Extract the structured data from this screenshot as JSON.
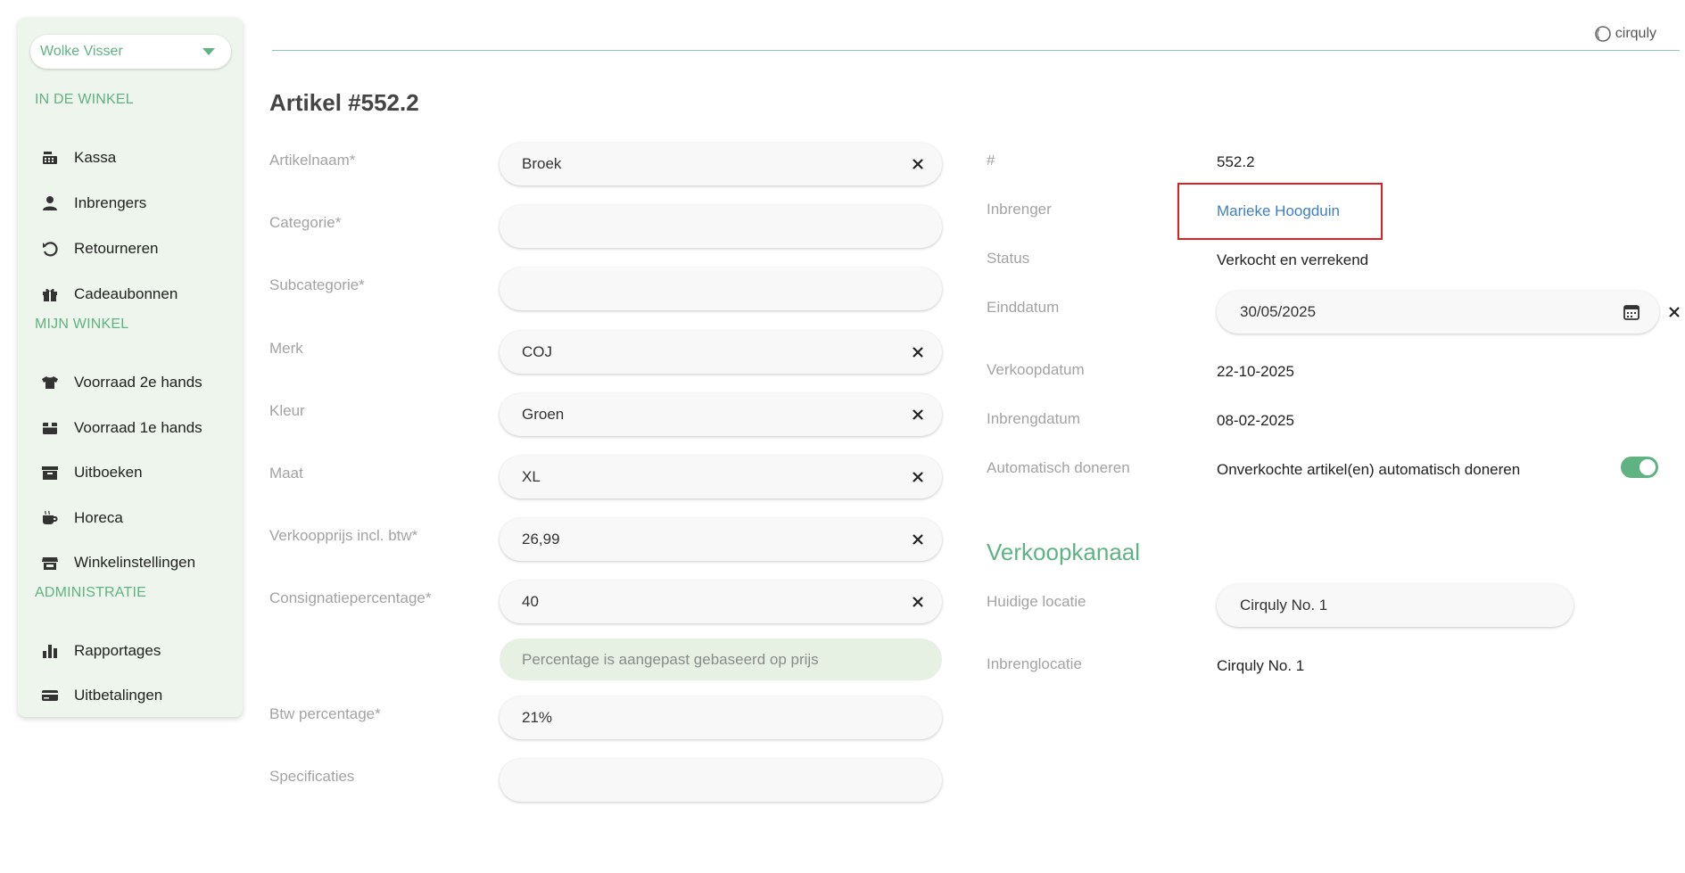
{
  "brand": {
    "name": "cirquly"
  },
  "sidebar": {
    "user": "Wolke Visser",
    "sections": [
      {
        "title": "IN DE WINKEL",
        "items": [
          {
            "label": "Kassa",
            "icon": "cash-register-icon"
          },
          {
            "label": "Inbrengers",
            "icon": "person-icon"
          },
          {
            "label": "Retourneren",
            "icon": "return-icon"
          },
          {
            "label": "Cadeaubonnen",
            "icon": "gift-icon"
          }
        ]
      },
      {
        "title": "MIJN WINKEL",
        "items": [
          {
            "label": "Voorraad 2e hands",
            "icon": "shirt-icon"
          },
          {
            "label": "Voorraad 1e hands",
            "icon": "box-icon"
          },
          {
            "label": "Uitboeken",
            "icon": "archive-icon"
          },
          {
            "label": "Horeca",
            "icon": "coffee-icon"
          },
          {
            "label": "Winkelinstellingen",
            "icon": "store-icon"
          }
        ]
      },
      {
        "title": "ADMINISTRATIE",
        "items": [
          {
            "label": "Rapportages",
            "icon": "bar-chart-icon"
          },
          {
            "label": "Uitbetalingen",
            "icon": "credit-card-icon"
          }
        ]
      }
    ]
  },
  "page": {
    "title": "Artikel #552.2"
  },
  "form": {
    "fields": [
      {
        "label": "Artikelnaam*",
        "value": "Broek",
        "clearable": true
      },
      {
        "label": "Categorie*",
        "value": "",
        "clearable": false
      },
      {
        "label": "Subcategorie*",
        "value": "",
        "clearable": false
      },
      {
        "label": "Merk",
        "value": "COJ",
        "clearable": true
      },
      {
        "label": "Kleur",
        "value": "Groen",
        "clearable": true
      },
      {
        "label": "Maat",
        "value": "XL",
        "clearable": true
      },
      {
        "label": "Verkoopprijs incl. btw*",
        "value": "26,99",
        "clearable": true
      },
      {
        "label": "Consignatiepercentage*",
        "value": "40",
        "clearable": true
      },
      {
        "label": "Btw percentage*",
        "value": "21%",
        "clearable": false
      },
      {
        "label": "Specificaties",
        "value": "",
        "clearable": false
      }
    ],
    "info": "Percentage is aangepast gebaseerd op prijs"
  },
  "details": {
    "id_label": "#",
    "id_value": "552.2",
    "consignor_label": "Inbrenger",
    "consignor_value": "Marieke Hoogduin",
    "status_label": "Status",
    "status_value": "Verkocht en verrekend",
    "enddate_label": "Einddatum",
    "enddate_value": "30/05/2025",
    "saledate_label": "Verkoopdatum",
    "saledate_value": "22-10-2025",
    "consigndate_label": "Inbrengdatum",
    "consigndate_value": "08-02-2025",
    "autodonate_label": "Automatisch doneren",
    "autodonate_value": "Onverkochte artikel(en) automatisch doneren",
    "autodonate_on": true
  },
  "channel": {
    "heading": "Verkoopkanaal",
    "current_label": "Huidige locatie",
    "current_value": "Cirquly No. 1",
    "consign_label": "Inbrenglocatie",
    "consign_value": "Cirquly No. 1"
  },
  "colors": {
    "accent": "#5fb382",
    "sidebar_bg": "#eef5ec",
    "link": "#3f7fbf",
    "highlight": "#e02020"
  }
}
